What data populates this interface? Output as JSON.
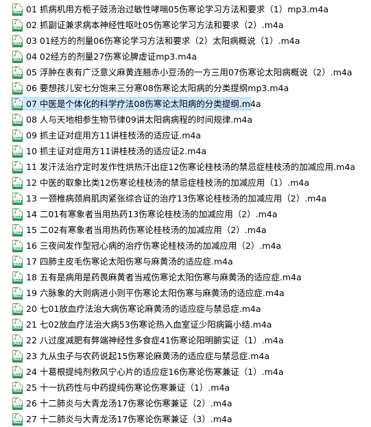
{
  "files": [
    {
      "name": "01 抓病机用方栀子豉汤治过敏性哮喘05伤寒论学习方法和要求（1）mp3.m4a",
      "selected": false
    },
    {
      "name": "02 抓副证兼求病本神经性呕吐05伤寒论学习方法和要求（2）.m4a",
      "selected": false
    },
    {
      "name": "03 01经方的剂量06伤寒论学习方法和要求（2）太阳病概说（1）.m4a",
      "selected": false
    },
    {
      "name": "04 02经方的剂量27伤寒论脾虚证mp3.m4a",
      "selected": false
    },
    {
      "name": "05 浮肿在表有广泛意义麻黄连翘赤小豆汤的一方三用07伤寒论太阳病概说（2）.m4a",
      "selected": false
    },
    {
      "name": "06 要想孩儿安七分饱来三分寒08伤寒论太阳病的分类提纲mp3.m4a",
      "selected": false
    },
    {
      "name": "07 中医是个体化的科学疗法08伤寒论太阳病的分类提纲.m4a",
      "selected": true
    },
    {
      "name": "08 人与天地相参生物节律09讲太阳病病程的时间规律.m4a",
      "selected": false
    },
    {
      "name": "09 抓主证对症用方11讲桂枝汤的适应证.m4a",
      "selected": false
    },
    {
      "name": "10 抓主证对症用方11讲桂枝汤的适应证2.m4a",
      "selected": false
    },
    {
      "name": "11 发汗法治疗定时发作性烘热汗出症12伤寒论桂枝汤的禁忌症桂枝汤的加减应用.m4a",
      "selected": false
    },
    {
      "name": "12 中医的取象比类12伤寒论桂枝汤的禁忌症桂枝汤的加减应用（1）.m4a",
      "selected": false
    },
    {
      "name": "13 一颈椎病颈肩肌肉紧张综合证的治疗13伤寒论桂枝汤的加减应用（2）.m4a",
      "selected": false
    },
    {
      "name": "14 二01有寒象者当用热药13伤寒论桂枝汤的加减应用（2）.m4a",
      "selected": false
    },
    {
      "name": "15 二02有寒象者当用热药伤寒论桂枝汤的加减应用（2）.m4a",
      "selected": false
    },
    {
      "name": "16 三夜间发作型冠心病的治疗伤寒论桂枝汤的加减应用（2）.m4a",
      "selected": false
    },
    {
      "name": "17 四肺主皮毛伤寒论太阳伤寒与麻黄汤的适应症.m4a",
      "selected": false
    },
    {
      "name": "18 五有是病用是药畏麻黄者当戒伤寒论太阳伤寒与麻黄汤的适应症.m4a",
      "selected": false
    },
    {
      "name": "19 六脉象的大则病进小则平伤寒论太阳伤寒与麻黄汤的适应症.m4a",
      "selected": false
    },
    {
      "name": "20 七01放血疗法治大病伤寒论麻黄汤的适应症与禁忌症.m4a",
      "selected": false
    },
    {
      "name": "21 七02放血疗法治大病53伤寒论热入血室证少阳病篇小结.m4a",
      "selected": false
    },
    {
      "name": "22 八过度减肥有弊端神经性多食症41伤寒论阳明腑实证（1）.m4a",
      "selected": false
    },
    {
      "name": "23 九从虫子与农药说起15伤寒论麻黄汤的适应症与禁忌症.m4a",
      "selected": false
    },
    {
      "name": "24 十葛根提纯剂救风宁心片的适应症16伤寒论伤寒兼证（1）.m4a",
      "selected": false
    },
    {
      "name": "25 十一抗药性与中药提纯伤寒论伤寒兼证（1）.m4a",
      "selected": false
    },
    {
      "name": "26 十二肺炎与大青龙汤17伤寒论伤寒兼证（2）.m4a",
      "selected": false
    },
    {
      "name": "27 十二肺炎与大青龙汤17伤寒论伤寒兼证（3）.m4a",
      "selected": false
    }
  ],
  "icon": {
    "badge_text": "M4A",
    "note_glyph": "♪",
    "type": "m4a-audio-file-icon"
  },
  "colors": {
    "selection_fill": "#cde8ff",
    "selection_border": "#99d1ff",
    "icon_badge": "#2e8f5a"
  }
}
